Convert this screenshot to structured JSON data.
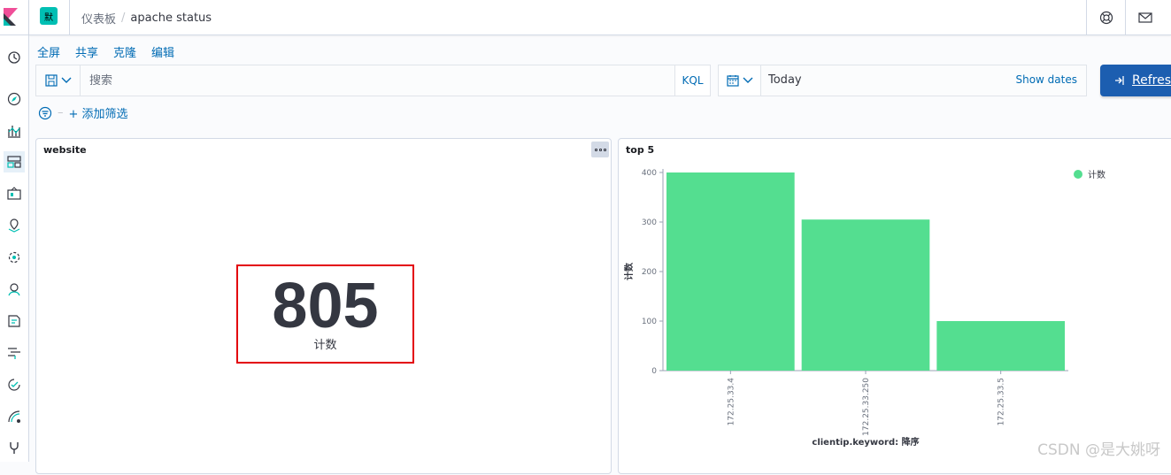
{
  "header": {
    "space_initial": "默",
    "breadcrumbs": [
      "仪表板",
      "apache status"
    ]
  },
  "top_menu": [
    "全屏",
    "共享",
    "克隆",
    "编辑"
  ],
  "query": {
    "placeholder": "搜索",
    "language": "KQL"
  },
  "date": {
    "value": "Today",
    "show_dates": "Show dates"
  },
  "refresh_label": "Refresh",
  "filter": {
    "add_label": "+ 添加筛选"
  },
  "panels": {
    "website": {
      "title": "website",
      "metric_value": "805",
      "metric_label": "计数"
    },
    "top5": {
      "title": "top 5"
    }
  },
  "chart_data": {
    "type": "bar",
    "title": "top 5",
    "categories": [
      "172.25.33.4",
      "172.25.33.250",
      "172.25.33.5"
    ],
    "series": [
      {
        "name": "计数",
        "values": [
          400,
          305,
          100
        ]
      }
    ],
    "xlabel": "clientip.keyword: 降序",
    "ylabel": "计数",
    "ylim": [
      0,
      400
    ],
    "yticks": [
      0,
      100,
      200,
      300,
      400
    ],
    "legend": "top-right",
    "color": "#54de90"
  },
  "watermark": "CSDN @是大姚呀"
}
